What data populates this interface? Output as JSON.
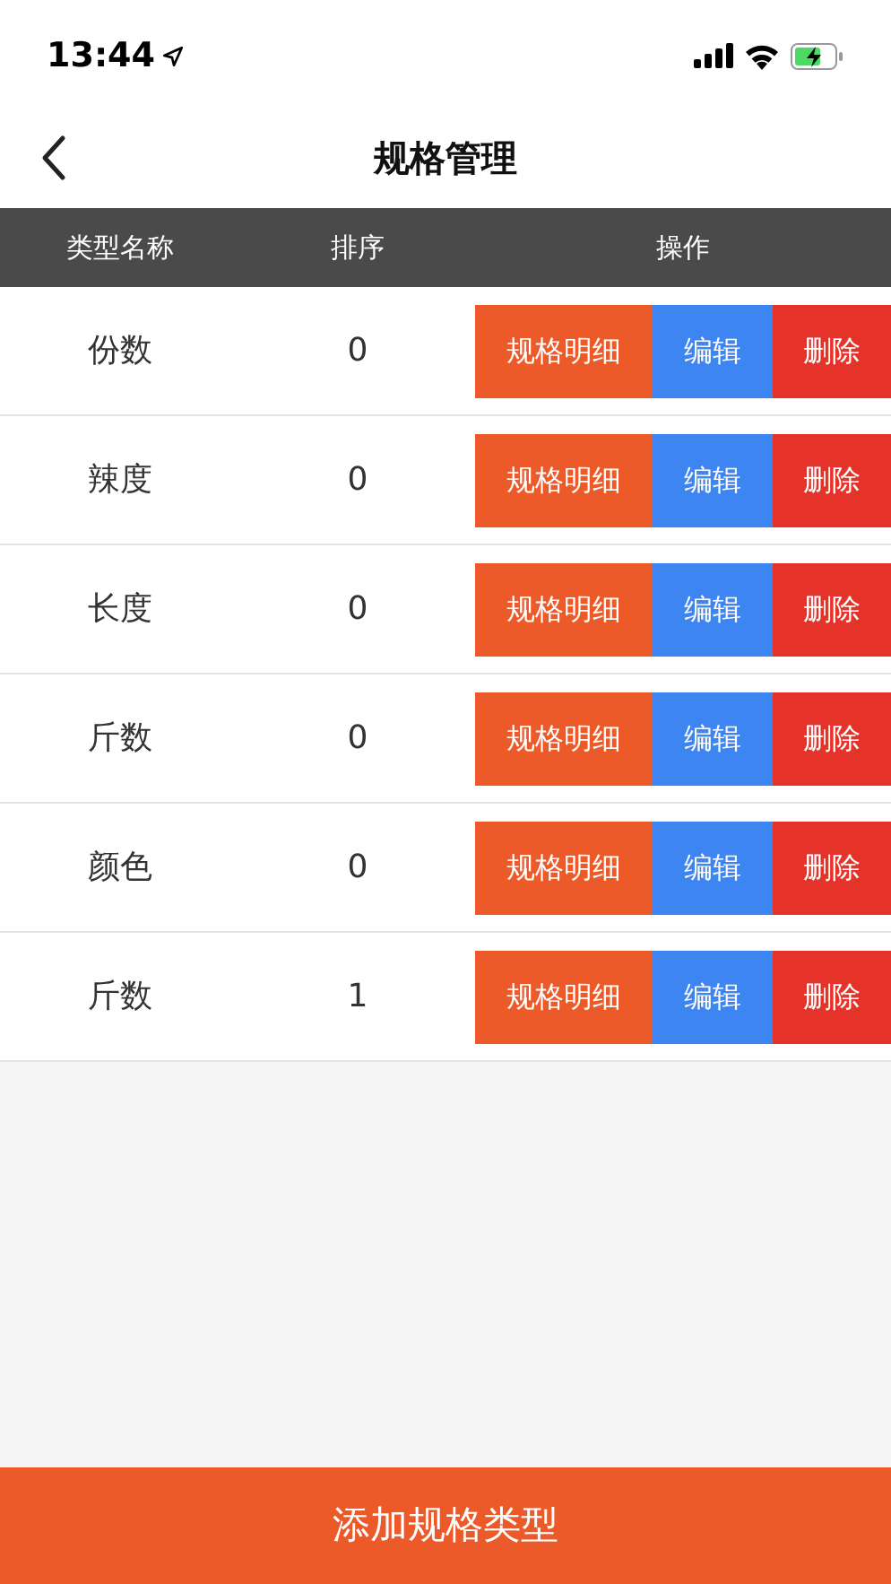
{
  "status_bar": {
    "time": "13:44"
  },
  "nav": {
    "title": "规格管理"
  },
  "table": {
    "columns": [
      "类型名称",
      "排序",
      "操作"
    ],
    "rows": [
      {
        "name": "份数",
        "order": "0",
        "actions": [
          {
            "kind": "detail",
            "label": "规格明细"
          },
          {
            "kind": "edit",
            "label": "编辑"
          },
          {
            "kind": "delete",
            "label": "删除"
          }
        ]
      },
      {
        "name": "辣度",
        "order": "0",
        "actions": [
          {
            "kind": "detail",
            "label": "规格明细"
          },
          {
            "kind": "edit",
            "label": "编辑"
          },
          {
            "kind": "delete",
            "label": "删除"
          }
        ]
      },
      {
        "name": "长度",
        "order": "0",
        "actions": [
          {
            "kind": "detail",
            "label": "规格明细"
          },
          {
            "kind": "edit",
            "label": "编辑"
          },
          {
            "kind": "delete",
            "label": "删除"
          }
        ]
      },
      {
        "name": "斤数",
        "order": "0",
        "actions": [
          {
            "kind": "detail",
            "label": "规格明细"
          },
          {
            "kind": "edit",
            "label": "编辑"
          },
          {
            "kind": "delete",
            "label": "删除"
          }
        ]
      },
      {
        "name": "颜色",
        "order": "0",
        "actions": [
          {
            "kind": "detail",
            "label": "规格明细"
          },
          {
            "kind": "edit",
            "label": "编辑"
          },
          {
            "kind": "delete",
            "label": "删除"
          }
        ]
      },
      {
        "name": "斤数",
        "order": "1",
        "actions": [
          {
            "kind": "detail",
            "label": "规格明细"
          },
          {
            "kind": "edit",
            "label": "编辑"
          },
          {
            "kind": "delete",
            "label": "删除"
          }
        ]
      }
    ]
  },
  "footer_button": "添加规格类型"
}
